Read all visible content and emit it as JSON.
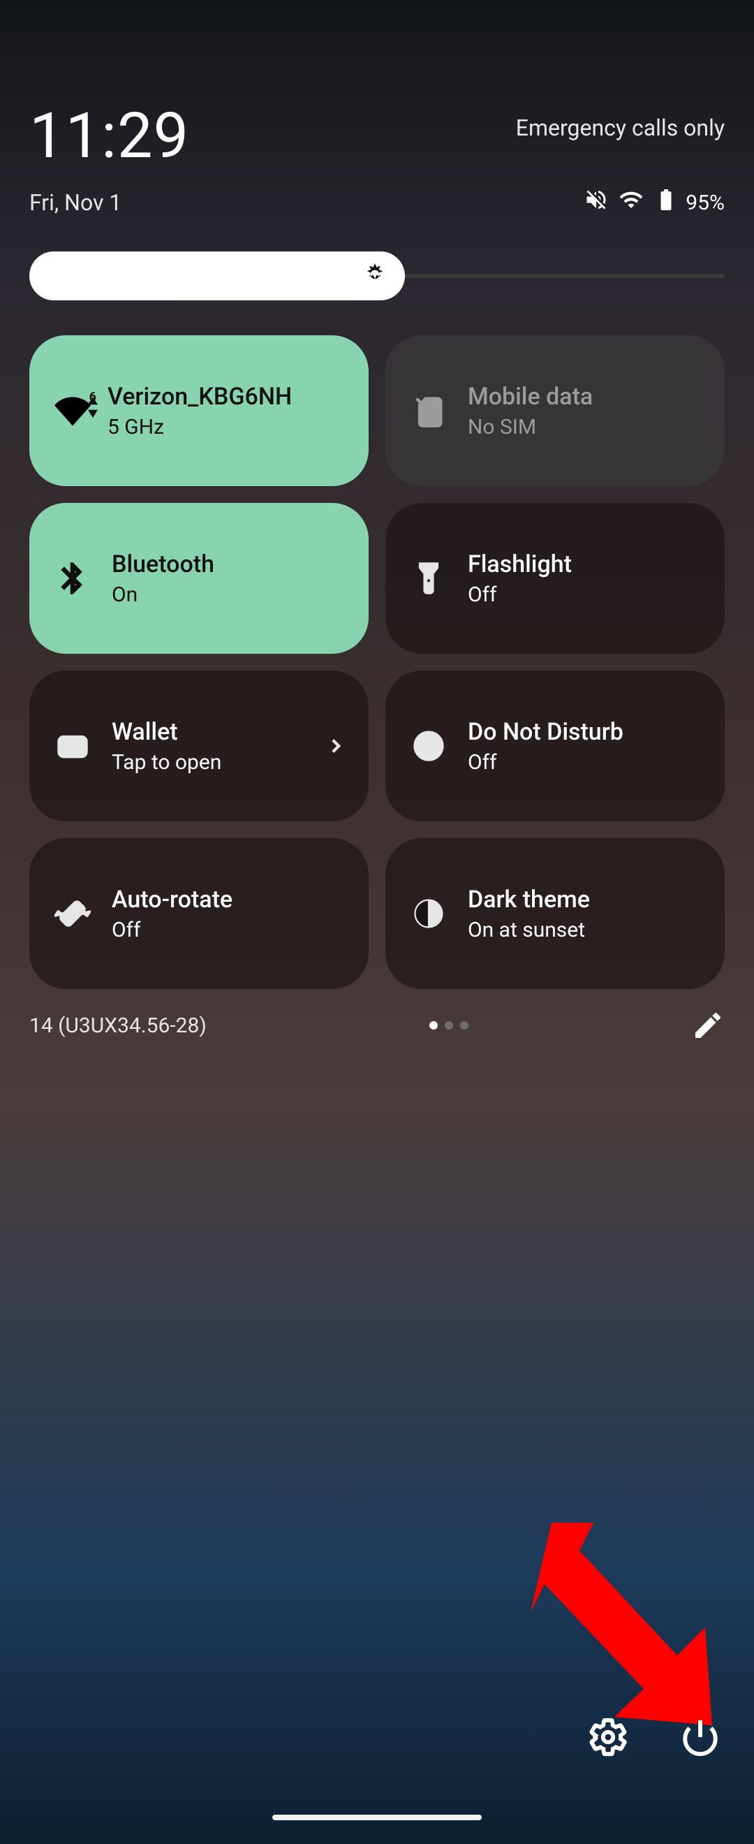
{
  "header": {
    "time": "11:29",
    "emergency": "Emergency calls only",
    "date": "Fri, Nov 1",
    "battery_pct": "95%"
  },
  "brightness": {
    "percent": 54
  },
  "tiles": {
    "wifi": {
      "label": "Verizon_KBG6NH",
      "sub": "5 GHz"
    },
    "mobile": {
      "label": "Mobile data",
      "sub": "No SIM"
    },
    "bluetooth": {
      "label": "Bluetooth",
      "sub": "On"
    },
    "flashlight": {
      "label": "Flashlight",
      "sub": "Off"
    },
    "wallet": {
      "label": "Wallet",
      "sub": "Tap to open"
    },
    "dnd": {
      "label": "Do Not Disturb",
      "sub": "Off"
    },
    "rotate": {
      "label": "Auto-rotate",
      "sub": "Off"
    },
    "dark": {
      "label": "Dark theme",
      "sub": "On at sunset"
    }
  },
  "footer": {
    "version": "14 (U3UX34.56-28)"
  }
}
